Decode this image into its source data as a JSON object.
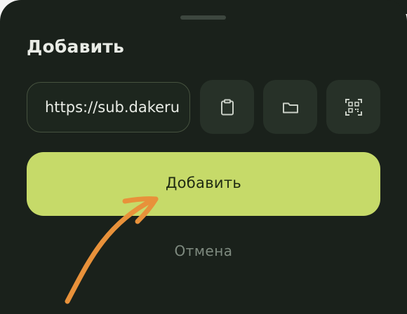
{
  "sheet": {
    "title": "Добавить"
  },
  "url_field": {
    "value": "https://sub.dakeru"
  },
  "buttons": {
    "paste_icon": "clipboard-icon",
    "folder_icon": "folder-icon",
    "qr_icon": "qr-scan-icon",
    "add_label": "Добавить",
    "cancel_label": "Отмена"
  },
  "colors": {
    "background": "#1a211b",
    "accent": "#c6da69",
    "annotation_arrow": "#e8913a"
  }
}
